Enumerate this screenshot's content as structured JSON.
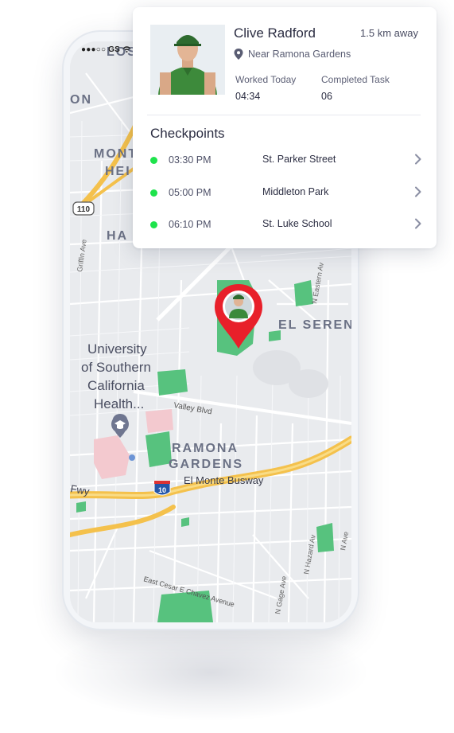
{
  "status_bar": {
    "text": "●●●○○ GS"
  },
  "profile": {
    "name": "Clive Radford",
    "distance": "1.5 km away",
    "location": "Near Ramona Gardens",
    "worked_today_label": "Worked Today",
    "worked_today_value": "04:34",
    "completed_task_label": "Completed Task",
    "completed_task_value": "06"
  },
  "checkpoints": {
    "title": "Checkpoints",
    "items": [
      {
        "time": "03:30 PM",
        "place": "St. Parker Street"
      },
      {
        "time": "05:00 PM",
        "place": "Middleton Park"
      },
      {
        "time": "06:10 PM",
        "place": "St. Luke School"
      }
    ]
  },
  "map": {
    "labels": {
      "los": "LOS",
      "on": "ON",
      "monterey": "MONT",
      "heights": "HEI",
      "ha": "HA",
      "hwy110": "110",
      "griffin": "Griffin Ave",
      "el_sereno": "EL SEREN",
      "usc_line1": "University",
      "usc_line2": "of Southern",
      "usc_line3": "California",
      "usc_line4": "Health...",
      "valley_blvd": "Valley Blvd",
      "ramona_line1": "RAMONA",
      "ramona_line2": "GARDENS",
      "el_monte": "El Monte Busway",
      "fwy": "Fwy",
      "hwy10": "10",
      "eastern_ave": "N Eastern Av",
      "hazard_ave": "N Hazard Av",
      "gage_ave": "N Gage Ave",
      "n_ave": "N Ave",
      "cesar_chavez": "East Cesar E Chavez Avenue"
    },
    "colors": {
      "background": "#e9ebee",
      "park": "#57c27e",
      "highway": "#f4c14c",
      "pin": "#e8202a"
    }
  }
}
